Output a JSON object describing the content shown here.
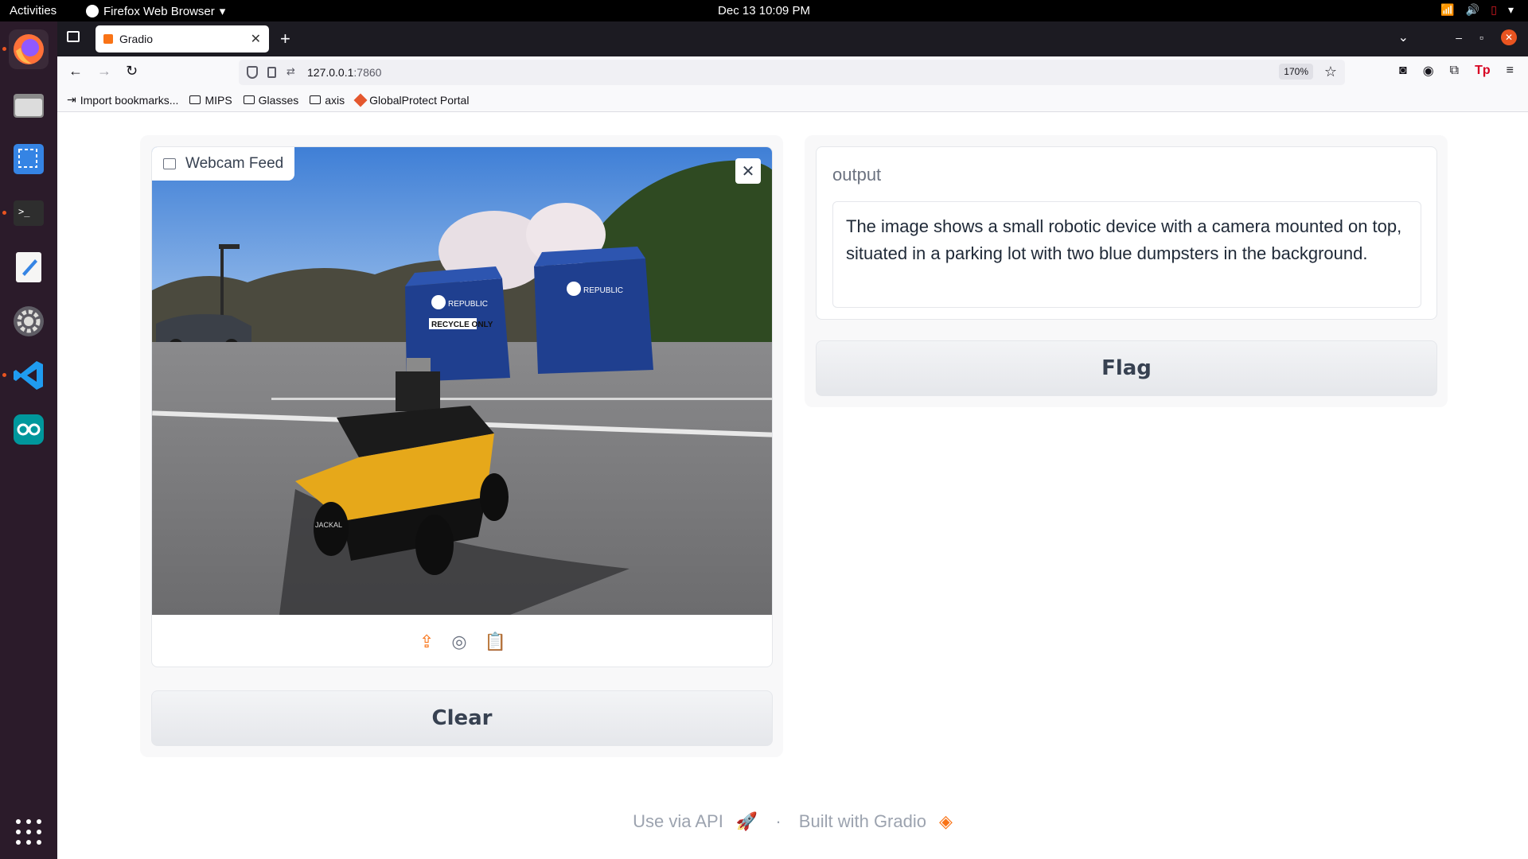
{
  "topbar": {
    "activities": "Activities",
    "app_name": "Firefox Web Browser",
    "clock": "Dec 13  10:09 PM"
  },
  "dock": {
    "items": [
      "firefox-icon",
      "files-icon",
      "screenshot-icon",
      "terminal-icon",
      "text-editor-icon",
      "settings-icon",
      "vscode-icon",
      "arduino-icon"
    ]
  },
  "browser": {
    "tab_title": "Gradio",
    "url_host": "127.0.0.1",
    "url_port": ":7860",
    "zoom": "170%",
    "bookmarks": [
      "Import bookmarks...",
      "MIPS",
      "Glasses",
      "axis",
      "GlobalProtect Portal"
    ]
  },
  "app": {
    "image_label": "Webcam Feed",
    "clear_button": "Clear",
    "output_label": "output",
    "output_text": "The image shows a small robotic device with a camera mounted on top, situated in a parking lot with two blue dumpsters in the background.",
    "flag_button": "Flag",
    "footer_api": "Use via API",
    "footer_sep": "·",
    "footer_built": "Built with Gradio",
    "image_text": {
      "dumpster_left": "RECYCLE ONLY",
      "dumpster_brand": "REPUBLIC",
      "robot_brand": "JACKAL"
    }
  },
  "colors": {
    "accent": "#f97316",
    "ubuntu_orange": "#e95420",
    "dumpster_blue": "#1f3f8f",
    "robot_yellow": "#e6a81a"
  }
}
